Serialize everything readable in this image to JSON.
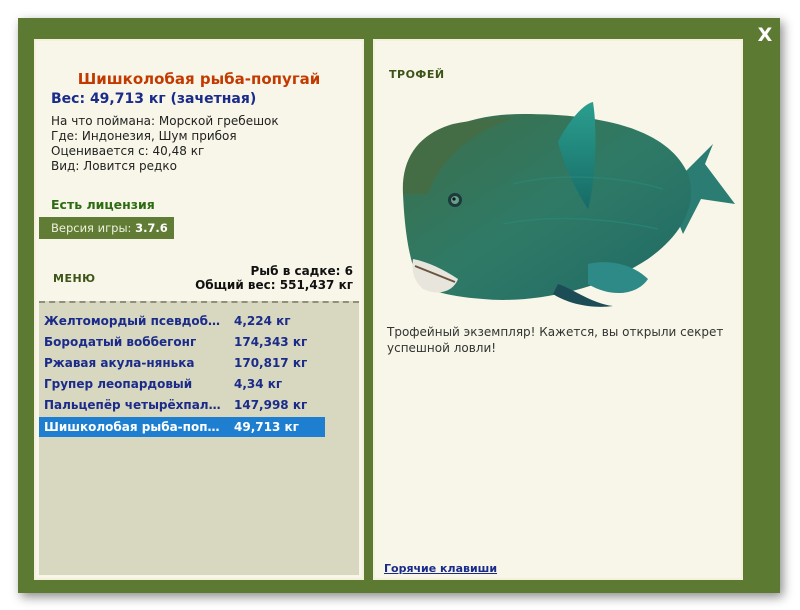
{
  "close_label": "X",
  "fish": {
    "name": "Шишколобая рыба-попугай",
    "weight_line": "Вес: 49,713 кг (зачетная)",
    "caught_on": "На что поймана: Морской гребешок",
    "where": "Где: Индонезия, Шум прибоя",
    "valued_from": "Оценивается с: 40,48 кг",
    "kind": "Вид: Ловится редко"
  },
  "license": "Есть лицензия",
  "version": {
    "label": "Версия игры:",
    "value": "3.7.6"
  },
  "menu_label": "МЕНЮ",
  "stats": {
    "count": "Рыб в садке: 6",
    "total": "Общий вес: 551,437 кг"
  },
  "catch_list": [
    {
      "name": "Желтомордый псевдоба...",
      "weight": "4,224 кг"
    },
    {
      "name": "Бородатый воббегонг",
      "weight": "174,343 кг"
    },
    {
      "name": "Ржавая акула-нянька",
      "weight": "170,817 кг"
    },
    {
      "name": "Групер леопардовый",
      "weight": "4,34 кг"
    },
    {
      "name": "Пальцепёр четырёхпал...",
      "weight": "147,998 кг"
    },
    {
      "name": "Шишколобая рыба-попу...",
      "weight": "49,713 кг"
    }
  ],
  "trophy_label": "ТРОФЕЙ",
  "trophy_message": "Трофейный экземпляр! Кажется, вы открыли секрет успешной ловли!",
  "hotkeys_label": "Горячие клавиши",
  "colors": {
    "frame": "#5c7a32",
    "panel": "#f7f6e8",
    "selection": "#1e7fd0",
    "title": "#c33a00",
    "link": "#1a2b8a"
  }
}
